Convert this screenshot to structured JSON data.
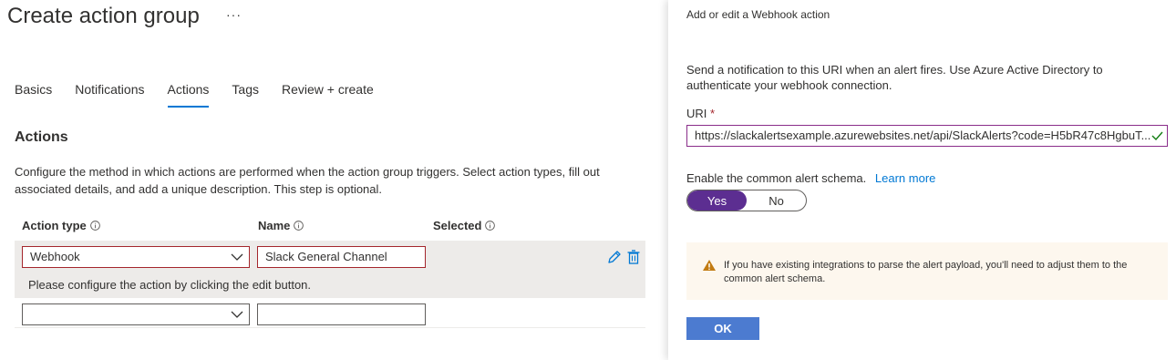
{
  "header": {
    "title": "Create action group",
    "more_label": "···"
  },
  "tabs": [
    {
      "label": "Basics"
    },
    {
      "label": "Notifications"
    },
    {
      "label": "Actions"
    },
    {
      "label": "Tags"
    },
    {
      "label": "Review + create"
    }
  ],
  "actions": {
    "section_title": "Actions",
    "description": "Configure the method in which actions are performed when the action group triggers. Select action types, fill out associated details, and add a unique description. This step is optional.",
    "columns": {
      "action_type": "Action type",
      "name": "Name",
      "selected": "Selected"
    },
    "rows": [
      {
        "action_type": "Webhook",
        "name": "Slack General Channel",
        "message": "Please configure the action by clicking the edit button."
      },
      {
        "action_type": "",
        "name": ""
      }
    ]
  },
  "panel": {
    "title": "Add or edit a Webhook action",
    "description": "Send a notification to this URI when an alert fires. Use Azure Active Directory to authenticate your webhook connection.",
    "uri_label": "URI",
    "uri_required": "*",
    "uri_value": "https://slackalertsexample.azurewebsites.net/api/SlackAlerts?code=H5bR47c8HgbuT...",
    "schema_label": "Enable the common alert schema.",
    "learn_more": "Learn more",
    "toggle_yes": "Yes",
    "toggle_no": "No",
    "warning": "If you have existing integrations to parse the alert payload, you'll need to adjust them to the common alert schema.",
    "ok_label": "OK"
  },
  "colors": {
    "accent": "#0078d4",
    "toggle_on": "#5c2e91",
    "error_border": "#a4262c",
    "warning_bg": "#fdf7ee",
    "warning_icon": "#c27b12"
  }
}
